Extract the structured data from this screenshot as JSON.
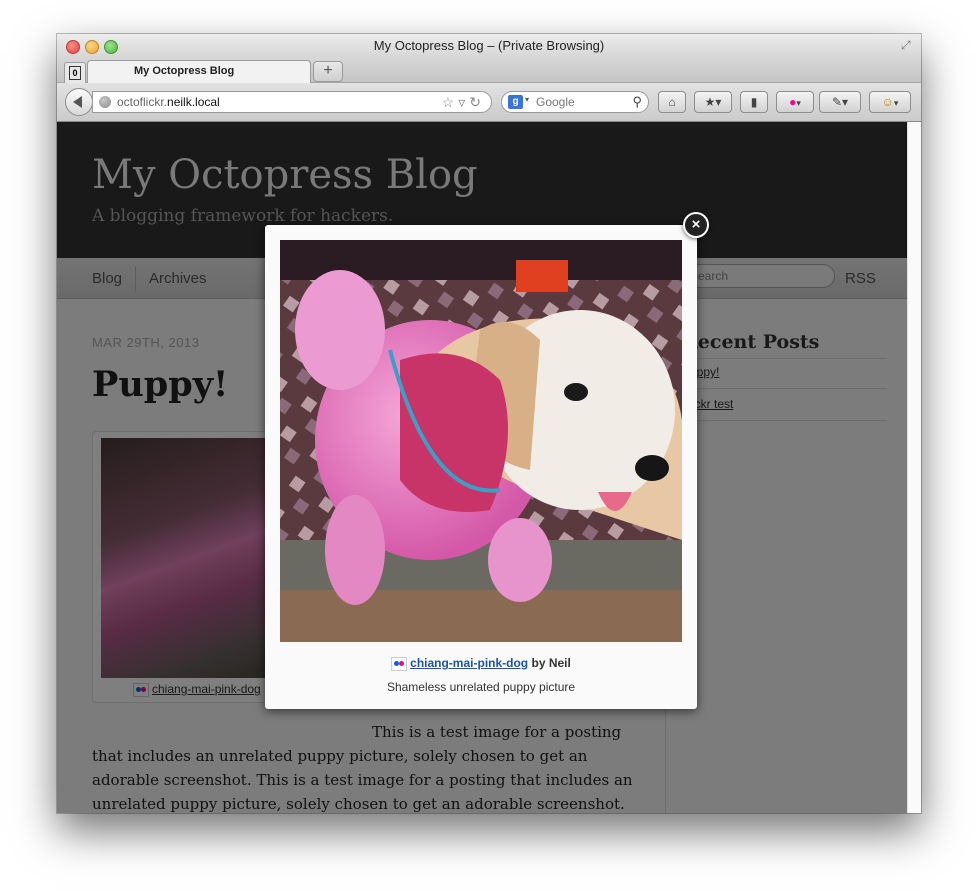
{
  "window": {
    "title": "My Octopress Blog – (Private Browsing)"
  },
  "tabs": [
    {
      "label": "My Octopress Blog",
      "active": true
    }
  ],
  "pinned_tab_label": "0",
  "new_tab_label": "+",
  "address": {
    "host_prefix": "octoflickr.",
    "host_domain": "neilk.local"
  },
  "search": {
    "engine_label": "g",
    "placeholder": "Google"
  },
  "page": {
    "blog_title": "My Octopress Blog",
    "blog_subtitle": "A blogging framework for hackers.",
    "nav": [
      "Blog",
      "Archives"
    ],
    "nav_search_placeholder": "Search",
    "nav_rss": "RSS",
    "post": {
      "date": "MAR 29TH, 2013",
      "title": "Puppy!",
      "figure_caption": "chiang-mai-pink-dog",
      "body": "This is a test image for a posting that includes an unrelated puppy picture, solely chosen to get an adorable screenshot. This is a test image for a posting that includes an unrelated puppy picture, solely chosen to get an adorable screenshot. This is a test"
    },
    "sidebar": {
      "heading": "Recent Posts",
      "items": [
        "Puppy!",
        "Flickr test"
      ]
    }
  },
  "lightbox": {
    "photo_title": "chiang-mai-pink-dog",
    "by": "by Neil",
    "description": "Shameless unrelated puppy picture",
    "close_label": "×"
  },
  "colors": {
    "header_bg": "#333333",
    "link": "#1a55a8",
    "flickr_blue": "#0063dc",
    "flickr_pink": "#ff0084"
  }
}
